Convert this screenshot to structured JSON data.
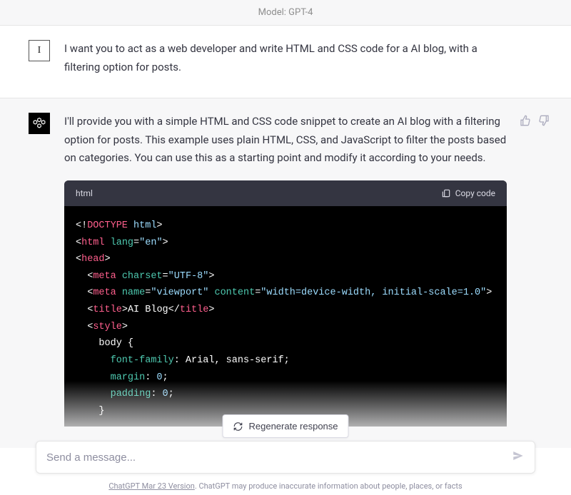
{
  "header": {
    "model_label": "Model: GPT-4"
  },
  "messages": {
    "user": {
      "avatar_text": "I",
      "text": "I want you to act as a web developer and write HTML and CSS code for a AI blog, with a filtering option for posts."
    },
    "assistant": {
      "text": "I'll provide you with a simple HTML and CSS code snippet to create an AI blog with a filtering option for posts. This example uses plain HTML, CSS, and JavaScript to filter the posts based on categories. You can use this as a starting point and modify it according to your needs."
    }
  },
  "code_block": {
    "language": "html",
    "copy_label": "Copy code",
    "tokens": [
      [
        [
          "<!",
          "tk-punc"
        ],
        [
          "DOCTYPE ",
          "tk-tag"
        ],
        [
          "html",
          "tk-doctype"
        ],
        [
          ">",
          "tk-punc"
        ]
      ],
      [
        [
          "<",
          "tk-punc"
        ],
        [
          "html ",
          "tk-tag"
        ],
        [
          "lang",
          "tk-attr"
        ],
        [
          "=",
          "tk-punc"
        ],
        [
          "\"en\"",
          "tk-str"
        ],
        [
          ">",
          "tk-punc"
        ]
      ],
      [
        [
          "<",
          "tk-punc"
        ],
        [
          "head",
          "tk-tag"
        ],
        [
          ">",
          "tk-punc"
        ]
      ],
      [
        [
          "  <",
          "tk-punc"
        ],
        [
          "meta ",
          "tk-tag"
        ],
        [
          "charset",
          "tk-attr"
        ],
        [
          "=",
          "tk-punc"
        ],
        [
          "\"UTF-8\"",
          "tk-str"
        ],
        [
          ">",
          "tk-punc"
        ]
      ],
      [
        [
          "  <",
          "tk-punc"
        ],
        [
          "meta ",
          "tk-tag"
        ],
        [
          "name",
          "tk-attr"
        ],
        [
          "=",
          "tk-punc"
        ],
        [
          "\"viewport\" ",
          "tk-str"
        ],
        [
          "content",
          "tk-attr"
        ],
        [
          "=",
          "tk-punc"
        ],
        [
          "\"width=device-width, initial-scale=1.0\"",
          "tk-str"
        ],
        [
          ">",
          "tk-punc"
        ]
      ],
      [
        [
          "  <",
          "tk-punc"
        ],
        [
          "title",
          "tk-tag"
        ],
        [
          ">",
          "tk-punc"
        ],
        [
          "AI Blog",
          "tk-plain"
        ],
        [
          "</",
          "tk-punc"
        ],
        [
          "title",
          "tk-tag"
        ],
        [
          ">",
          "tk-punc"
        ]
      ],
      [
        [
          "  <",
          "tk-punc"
        ],
        [
          "style",
          "tk-tag"
        ],
        [
          ">",
          "tk-punc"
        ]
      ],
      [
        [
          "    body {",
          "tk-sel"
        ]
      ],
      [
        [
          "      ",
          "tk-plain"
        ],
        [
          "font-family",
          "tk-prop"
        ],
        [
          ": Arial, sans-serif;",
          "tk-plain"
        ]
      ],
      [
        [
          "      ",
          "tk-plain"
        ],
        [
          "margin",
          "tk-prop"
        ],
        [
          ": ",
          "tk-plain"
        ],
        [
          "0",
          "tk-num"
        ],
        [
          ";",
          "tk-plain"
        ]
      ],
      [
        [
          "      ",
          "tk-plain"
        ],
        [
          "padding",
          "tk-prop"
        ],
        [
          ": ",
          "tk-plain"
        ],
        [
          "0",
          "tk-num"
        ],
        [
          ";",
          "tk-plain"
        ]
      ],
      [
        [
          "    }",
          "tk-sel"
        ]
      ]
    ]
  },
  "actions": {
    "regenerate_label": "Regenerate response"
  },
  "input": {
    "placeholder": "Send a message..."
  },
  "footer": {
    "version": "ChatGPT Mar 23 Version",
    "disclaimer": ". ChatGPT may produce inaccurate information about people, places, or facts"
  }
}
